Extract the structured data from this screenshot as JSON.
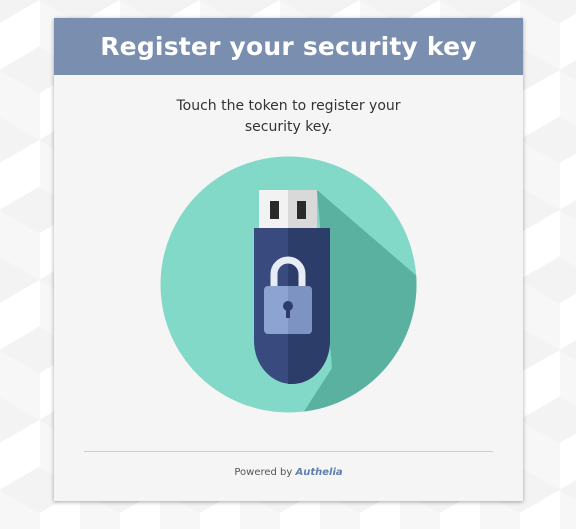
{
  "header": {
    "title": "Register your security key"
  },
  "main": {
    "instruction": "Touch the token to register your security key.",
    "illustration_icon": "usb-security-key-icon"
  },
  "footer": {
    "powered_by": "Powered by",
    "brand": "Authelia"
  },
  "colors": {
    "header_background": "#7a8eb0",
    "circle": "#82d9c8",
    "circle_shadow": "#5bb19f",
    "key_body": "#394b7e",
    "key_body_dark": "#2c3d69",
    "lock": "#8da3d1",
    "link": "#5d7fad"
  }
}
